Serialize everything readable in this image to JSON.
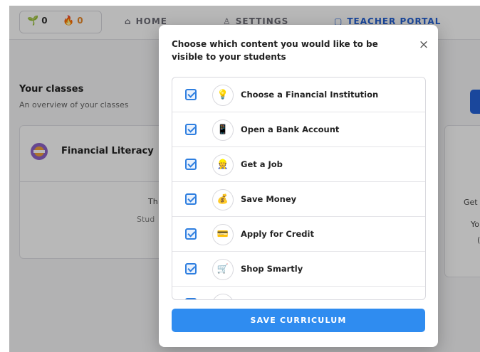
{
  "topbar": {
    "gems": "0",
    "streak": "0",
    "nav": [
      {
        "label": "HOME",
        "icon": "home-icon"
      },
      {
        "label": "SETTINGS",
        "icon": "user-icon"
      },
      {
        "label": "TEACHER PORTAL",
        "icon": "portal-icon"
      }
    ],
    "accent_color": "#2563d8"
  },
  "dashboard": {
    "title": "Your classes",
    "subtitle": "An overview of your classes",
    "class_card": {
      "name": "Financial Literacy",
      "text1": "Th",
      "text2": "Stud"
    },
    "side_card": {
      "text1": "Get",
      "text2": "Yo",
      "text3": "("
    }
  },
  "modal": {
    "title": "Choose which content you would like to be visible to your students",
    "close_label": "×",
    "items": [
      {
        "label": "Choose a Financial Institution",
        "checked": true,
        "icon": "lightbulb-icon"
      },
      {
        "label": "Open a Bank Account",
        "checked": true,
        "icon": "phone-icon"
      },
      {
        "label": "Get a Job",
        "checked": true,
        "icon": "worker-icon"
      },
      {
        "label": "Save Money",
        "checked": true,
        "icon": "money-bag-icon"
      },
      {
        "label": "Apply for Credit",
        "checked": true,
        "icon": "credit-card-icon"
      },
      {
        "label": "Shop Smartly",
        "checked": true,
        "icon": "shopping-cart-icon"
      },
      {
        "label": "",
        "checked": true,
        "icon": "item-icon"
      }
    ],
    "save_label": "SAVE CURRICULUM",
    "button_color": "#2f8cf0"
  }
}
